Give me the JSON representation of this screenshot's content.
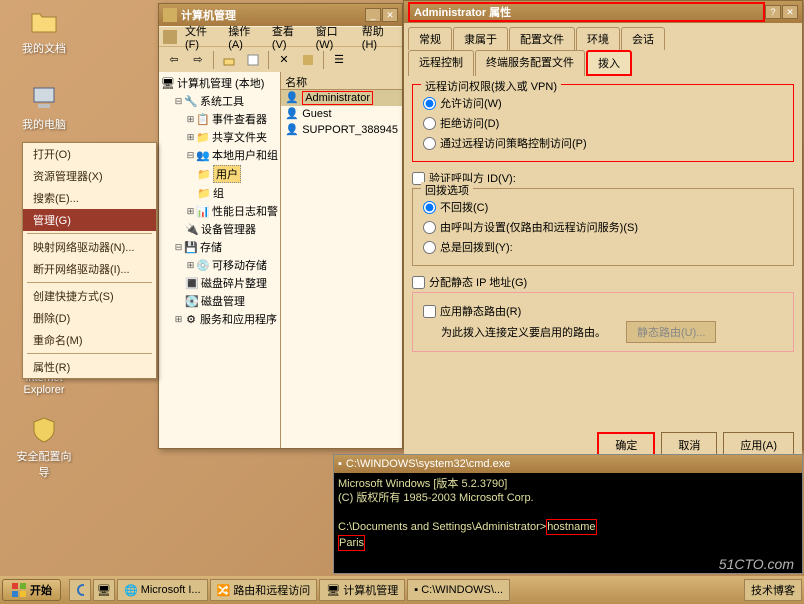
{
  "desktop": {
    "my_docs": "我的文档",
    "my_computer": "我的电脑",
    "ie": "Internet Explorer",
    "security_wizard": "安全配置向导"
  },
  "context_menu": {
    "open": "打开(O)",
    "explorer": "资源管理器(X)",
    "search": "搜索(E)...",
    "manage": "管理(G)",
    "map_drive": "映射网络驱动器(N)...",
    "disconnect_drive": "断开网络驱动器(I)...",
    "create_shortcut": "创建快捷方式(S)",
    "delete": "删除(D)",
    "rename": "重命名(M)",
    "properties": "属性(R)"
  },
  "mmc": {
    "title": "计算机管理",
    "menu": {
      "file": "文件(F)",
      "action": "操作(A)",
      "view": "查看(V)",
      "window": "窗口(W)",
      "help": "帮助(H)"
    },
    "tree": {
      "root": "计算机管理 (本地)",
      "system_tools": "系统工具",
      "event_viewer": "事件查看器",
      "shared_folders": "共享文件夹",
      "local_users": "本地用户和组",
      "users": "用户",
      "groups": "组",
      "perf_logs": "性能日志和警",
      "device_mgr": "设备管理器",
      "storage": "存储",
      "removable": "可移动存储",
      "defrag": "磁盘碎片整理",
      "disk_mgmt": "磁盘管理",
      "services": "服务和应用程序"
    },
    "list": {
      "header": "名称",
      "admin": "Administrator",
      "guest": "Guest",
      "support": "SUPPORT_388945"
    }
  },
  "props": {
    "title": "Administrator 属性",
    "tabs": {
      "general": "常规",
      "member": "隶属于",
      "profile": "配置文件",
      "env": "环境",
      "session": "会话",
      "remote": "远程控制",
      "ts_profile": "终端服务配置文件",
      "dialin": "拨入"
    },
    "access_group": "远程访问权限(拨入或 VPN)",
    "allow": "允许访问(W)",
    "deny": "拒绝访问(D)",
    "policy": "通过远程访问策略控制访问(P)",
    "verify_caller": "验证呼叫方 ID(V):",
    "callback_group": "回拨选项",
    "no_callback": "不回拨(C)",
    "caller_set": "由呼叫方设置(仅路由和远程访问服务)(S)",
    "always_callback": "总是回拨到(Y):",
    "assign_ip": "分配静态 IP 地址(G)",
    "apply_routes": "应用静态路由(R)",
    "route_desc": "为此拨入连接定义要启用的路由。",
    "static_routes_btn": "静态路由(U)...",
    "ok": "确定",
    "cancel": "取消",
    "apply": "应用(A)"
  },
  "cmd": {
    "title": "C:\\WINDOWS\\system32\\cmd.exe",
    "line1": "Microsoft Windows [版本 5.2.3790]",
    "line2": "(C) 版权所有 1985-2003 Microsoft Corp.",
    "prompt": "C:\\Documents and Settings\\Administrator>",
    "command": "hostname",
    "output": "Paris"
  },
  "taskbar": {
    "start": "开始",
    "ie": "Microsoft I...",
    "rras": "路由和远程访问",
    "mmc": "计算机管理",
    "cmd_short": "C:\\WINDOWS\\...",
    "blog": "技术博客"
  },
  "watermark": "51CTO.com"
}
